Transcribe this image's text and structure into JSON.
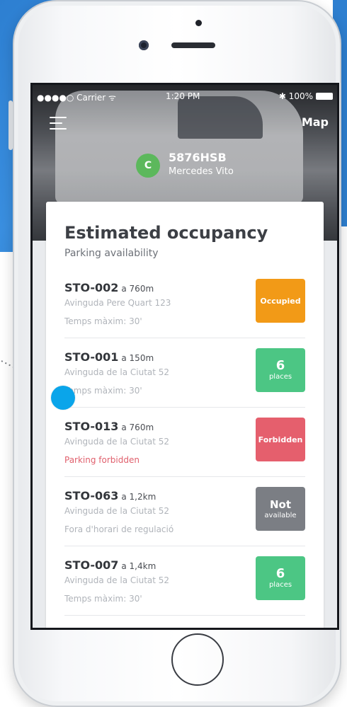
{
  "status_bar": {
    "carrier": "●●●●○ Carrier ᯤ",
    "time": "1:20 PM",
    "battery": "✱ 100%"
  },
  "header": {
    "map_label": "Map",
    "avatar_letter": "C",
    "plate": "5876HSB",
    "model": "Mercedes Vito"
  },
  "card": {
    "title": "Estimated occupancy",
    "subtitle": "Parking availability"
  },
  "spots": [
    {
      "code": "STO-002",
      "distance": "a 760m",
      "address": "Avinguda Pere Quart 123",
      "info": "Temps màxim: 30'",
      "badge_main": "Occupied",
      "badge_sub": "",
      "status_color": "#f29a17"
    },
    {
      "code": "STO-001",
      "distance": "a 150m",
      "address": "Avinguda de la Ciutat 52",
      "info": "Temps màxim: 30'",
      "badge_main": "6",
      "badge_sub": "places",
      "status_color": "#4cc684"
    },
    {
      "code": "STO-013",
      "distance": "a 760m",
      "address": "Avinguda de la Ciutat 52",
      "info": "Parking forbidden",
      "badge_main": "Forbidden",
      "badge_sub": "",
      "status_color": "#e55f6d"
    },
    {
      "code": "STO-063",
      "distance": "a 1,2km",
      "address": "Avinguda de la Ciutat 52",
      "info": "Fora d'horari de regulació",
      "badge_main": "Not",
      "badge_sub": "available",
      "status_color": "#7b7e84"
    },
    {
      "code": "STO-007",
      "distance": "a 1,4km",
      "address": "Avinguda de la Ciutat 52",
      "info": "Temps màxim: 30'",
      "badge_main": "6",
      "badge_sub": "places",
      "status_color": "#4cc684"
    }
  ],
  "colors": {
    "background_blue": "#2d7fd1",
    "marker_blue": "#0aa5ea",
    "available_green": "#4cc684",
    "occupied_orange": "#f29a17",
    "forbidden_red": "#e55f6d",
    "unavailable_gray": "#7b7e84"
  },
  "icons": {
    "menu": "hamburger-menu-icon",
    "marker": "location-marker-icon"
  }
}
